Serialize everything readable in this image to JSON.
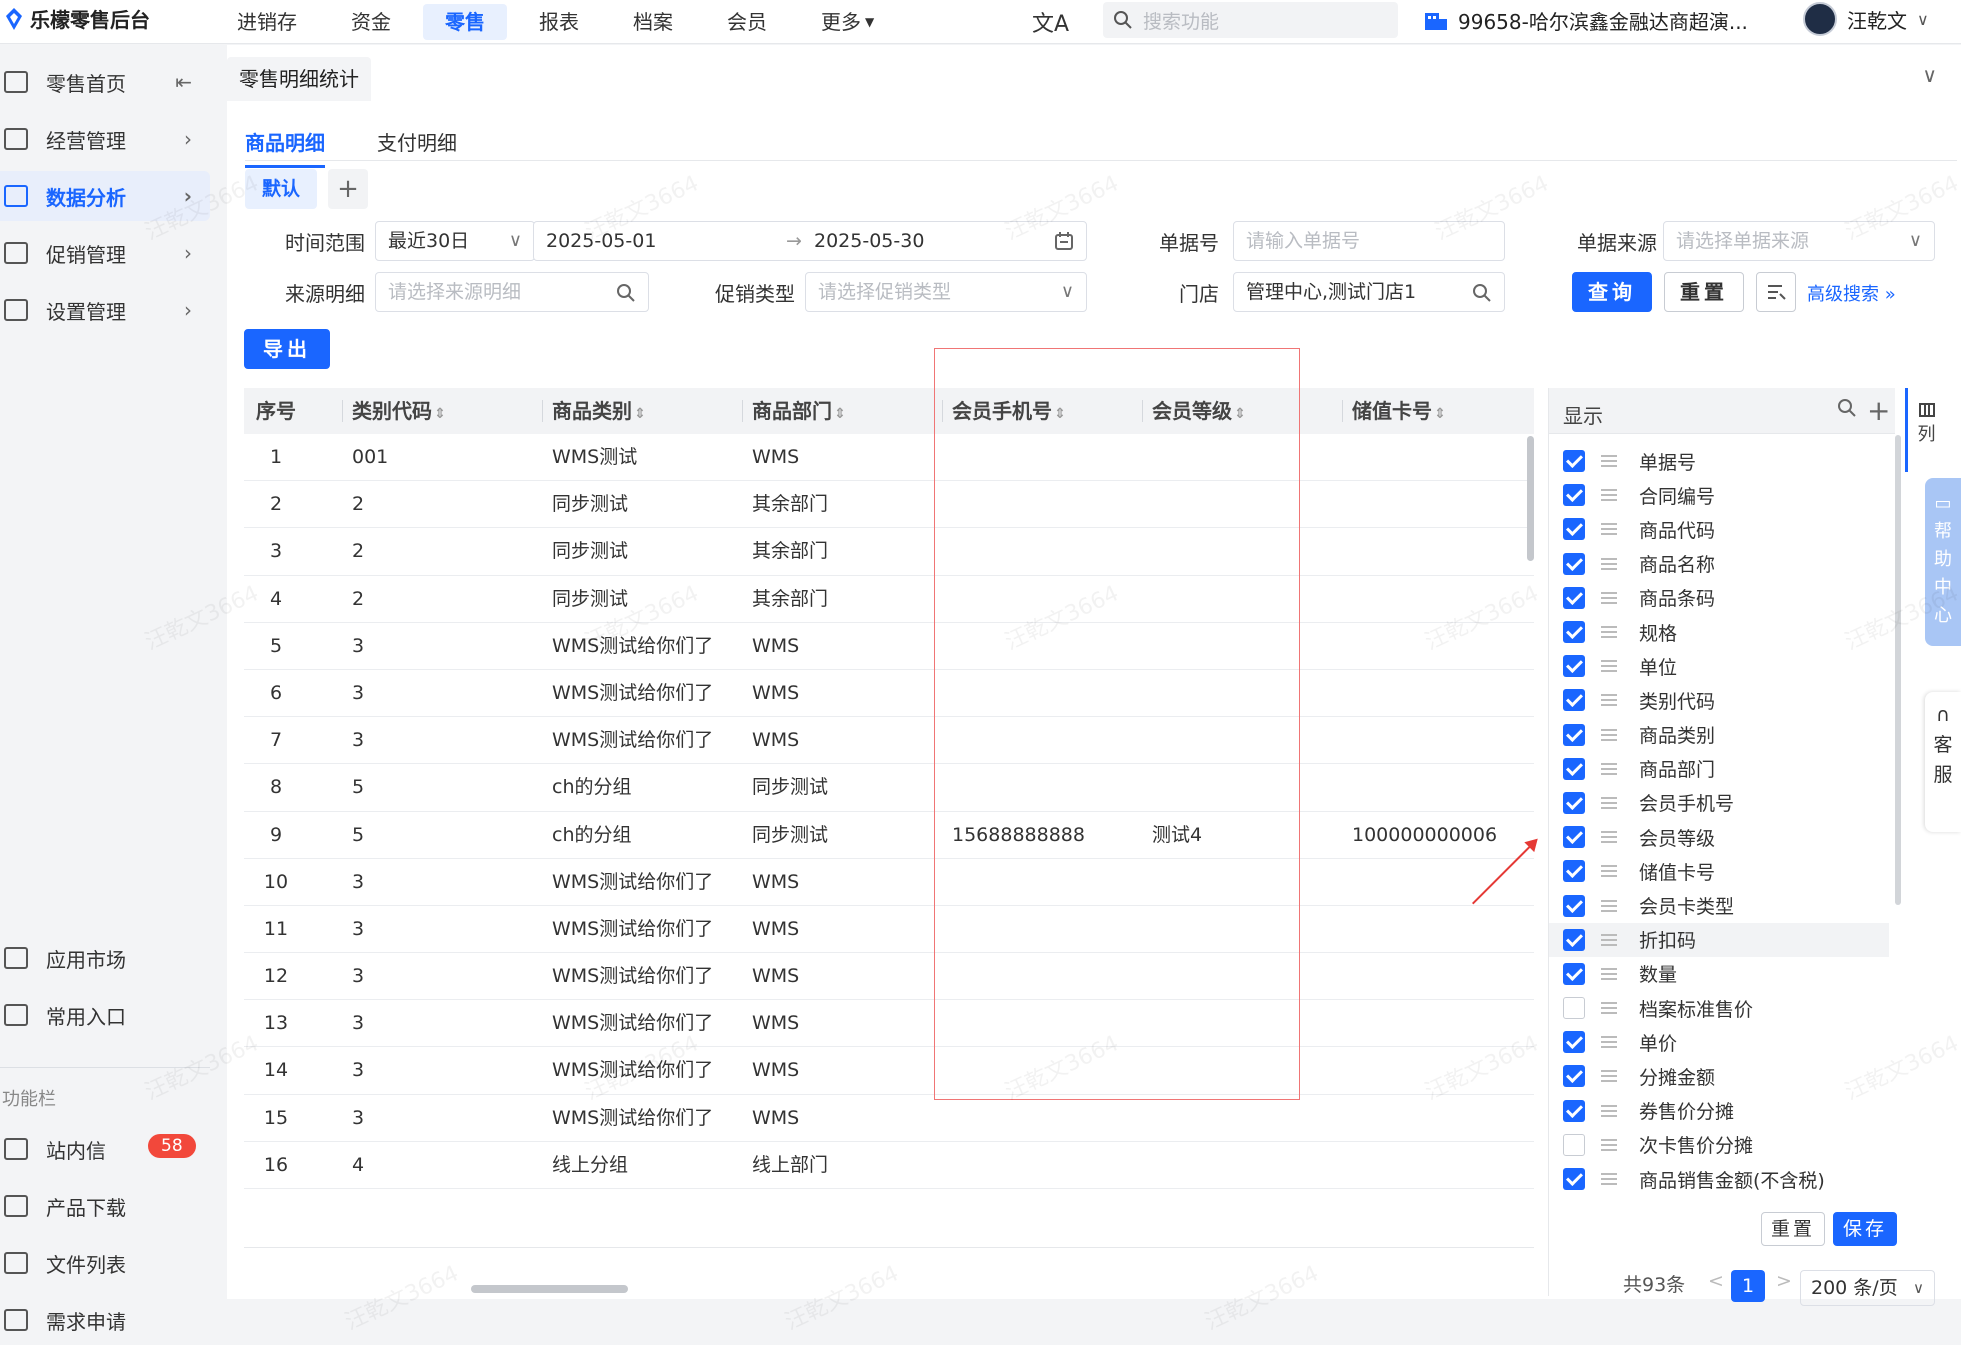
{
  "app": {
    "title": "乐檬零售后台"
  },
  "topnav": {
    "items": [
      "进销存",
      "资金",
      "零售",
      "报表",
      "档案",
      "会员",
      "更多"
    ],
    "active_index": 2,
    "search_placeholder": "搜索功能",
    "store": "99658-哈尔滨鑫金融达商超演...",
    "user": "汪乾文"
  },
  "sidebar": {
    "items": [
      "零售首页",
      "经营管理",
      "数据分析",
      "促销管理",
      "设置管理"
    ],
    "active_index": 2,
    "bottom_items": [
      "应用市场",
      "常用入口"
    ],
    "section_label": "功能栏",
    "func_items": [
      "站内信",
      "产品下载",
      "文件列表",
      "需求申请"
    ],
    "message_badge": "58"
  },
  "page": {
    "tab_title": "零售明细统计",
    "subtabs": [
      "商品明细",
      "支付明细"
    ],
    "active_subtab": 0,
    "preset_default": "默认",
    "preset_add": "+"
  },
  "filters": {
    "time_range_label": "时间范围",
    "time_range_value": "最近30日",
    "date_start": "2025-05-01",
    "date_end": "2025-05-30",
    "doc_no_label": "单据号",
    "doc_no_placeholder": "请输入单据号",
    "doc_source_label": "单据来源",
    "doc_source_placeholder": "请选择单据来源",
    "source_detail_label": "来源明细",
    "source_detail_placeholder": "请选择来源明细",
    "promo_type_label": "促销类型",
    "promo_type_placeholder": "请选择促销类型",
    "store_label": "门店",
    "store_value": "管理中心,测试门店1",
    "query_label": "查询",
    "reset_label": "重置",
    "advanced_label": "高级搜索"
  },
  "toolbar": {
    "export_label": "导出"
  },
  "table": {
    "columns": [
      "序号",
      "类别代码",
      "商品类别",
      "商品部门",
      "会员手机号",
      "会员等级",
      "储值卡号"
    ],
    "rows": [
      [
        "1",
        "001",
        "WMS测试",
        "WMS",
        "",
        "",
        ""
      ],
      [
        "2",
        "2",
        "同步测试",
        "其余部门",
        "",
        "",
        ""
      ],
      [
        "3",
        "2",
        "同步测试",
        "其余部门",
        "",
        "",
        ""
      ],
      [
        "4",
        "2",
        "同步测试",
        "其余部门",
        "",
        "",
        ""
      ],
      [
        "5",
        "3",
        "WMS测试给你们了",
        "WMS",
        "",
        "",
        ""
      ],
      [
        "6",
        "3",
        "WMS测试给你们了",
        "WMS",
        "",
        "",
        ""
      ],
      [
        "7",
        "3",
        "WMS测试给你们了",
        "WMS",
        "",
        "",
        ""
      ],
      [
        "8",
        "5",
        "ch的分组",
        "同步测试",
        "",
        "",
        ""
      ],
      [
        "9",
        "5",
        "ch的分组",
        "同步测试",
        "15688888888",
        "测试4",
        "100000000006"
      ],
      [
        "10",
        "3",
        "WMS测试给你们了",
        "WMS",
        "",
        "",
        ""
      ],
      [
        "11",
        "3",
        "WMS测试给你们了",
        "WMS",
        "",
        "",
        ""
      ],
      [
        "12",
        "3",
        "WMS测试给你们了",
        "WMS",
        "",
        "",
        ""
      ],
      [
        "13",
        "3",
        "WMS测试给你们了",
        "WMS",
        "",
        "",
        ""
      ],
      [
        "14",
        "3",
        "WMS测试给你们了",
        "WMS",
        "",
        "",
        ""
      ],
      [
        "15",
        "3",
        "WMS测试给你们了",
        "WMS",
        "",
        "",
        ""
      ],
      [
        "16",
        "4",
        "线上分组",
        "线上部门",
        "",
        "",
        ""
      ]
    ]
  },
  "column_panel": {
    "title": "显示",
    "items": [
      {
        "label": "单据号",
        "checked": true
      },
      {
        "label": "合同编号",
        "checked": true
      },
      {
        "label": "商品代码",
        "checked": true
      },
      {
        "label": "商品名称",
        "checked": true
      },
      {
        "label": "商品条码",
        "checked": true
      },
      {
        "label": "规格",
        "checked": true
      },
      {
        "label": "单位",
        "checked": true
      },
      {
        "label": "类别代码",
        "checked": true
      },
      {
        "label": "商品类别",
        "checked": true
      },
      {
        "label": "商品部门",
        "checked": true
      },
      {
        "label": "会员手机号",
        "checked": true
      },
      {
        "label": "会员等级",
        "checked": true
      },
      {
        "label": "储值卡号",
        "checked": true
      },
      {
        "label": "会员卡类型",
        "checked": true
      },
      {
        "label": "折扣码",
        "checked": true
      },
      {
        "label": "数量",
        "checked": true
      },
      {
        "label": "档案标准售价",
        "checked": false
      },
      {
        "label": "单价",
        "checked": true
      },
      {
        "label": "分摊金额",
        "checked": true
      },
      {
        "label": "券售价分摊",
        "checked": true
      },
      {
        "label": "次卡售价分摊",
        "checked": false
      },
      {
        "label": "商品销售金额(不含税)",
        "checked": true
      }
    ],
    "highlight_index": 14,
    "reset_label": "重置",
    "save_label": "保存"
  },
  "side_tabs": {
    "columns_label": "列",
    "help_label": "帮助中心",
    "service_label": "客服"
  },
  "pagination": {
    "total": "共93条",
    "current_page": "1",
    "page_size": "200 条/页"
  },
  "watermark": "汪乾文3664",
  "colors": {
    "primary": "#1a66ff",
    "badge": "#f2483b",
    "annotation": "#e53935"
  }
}
